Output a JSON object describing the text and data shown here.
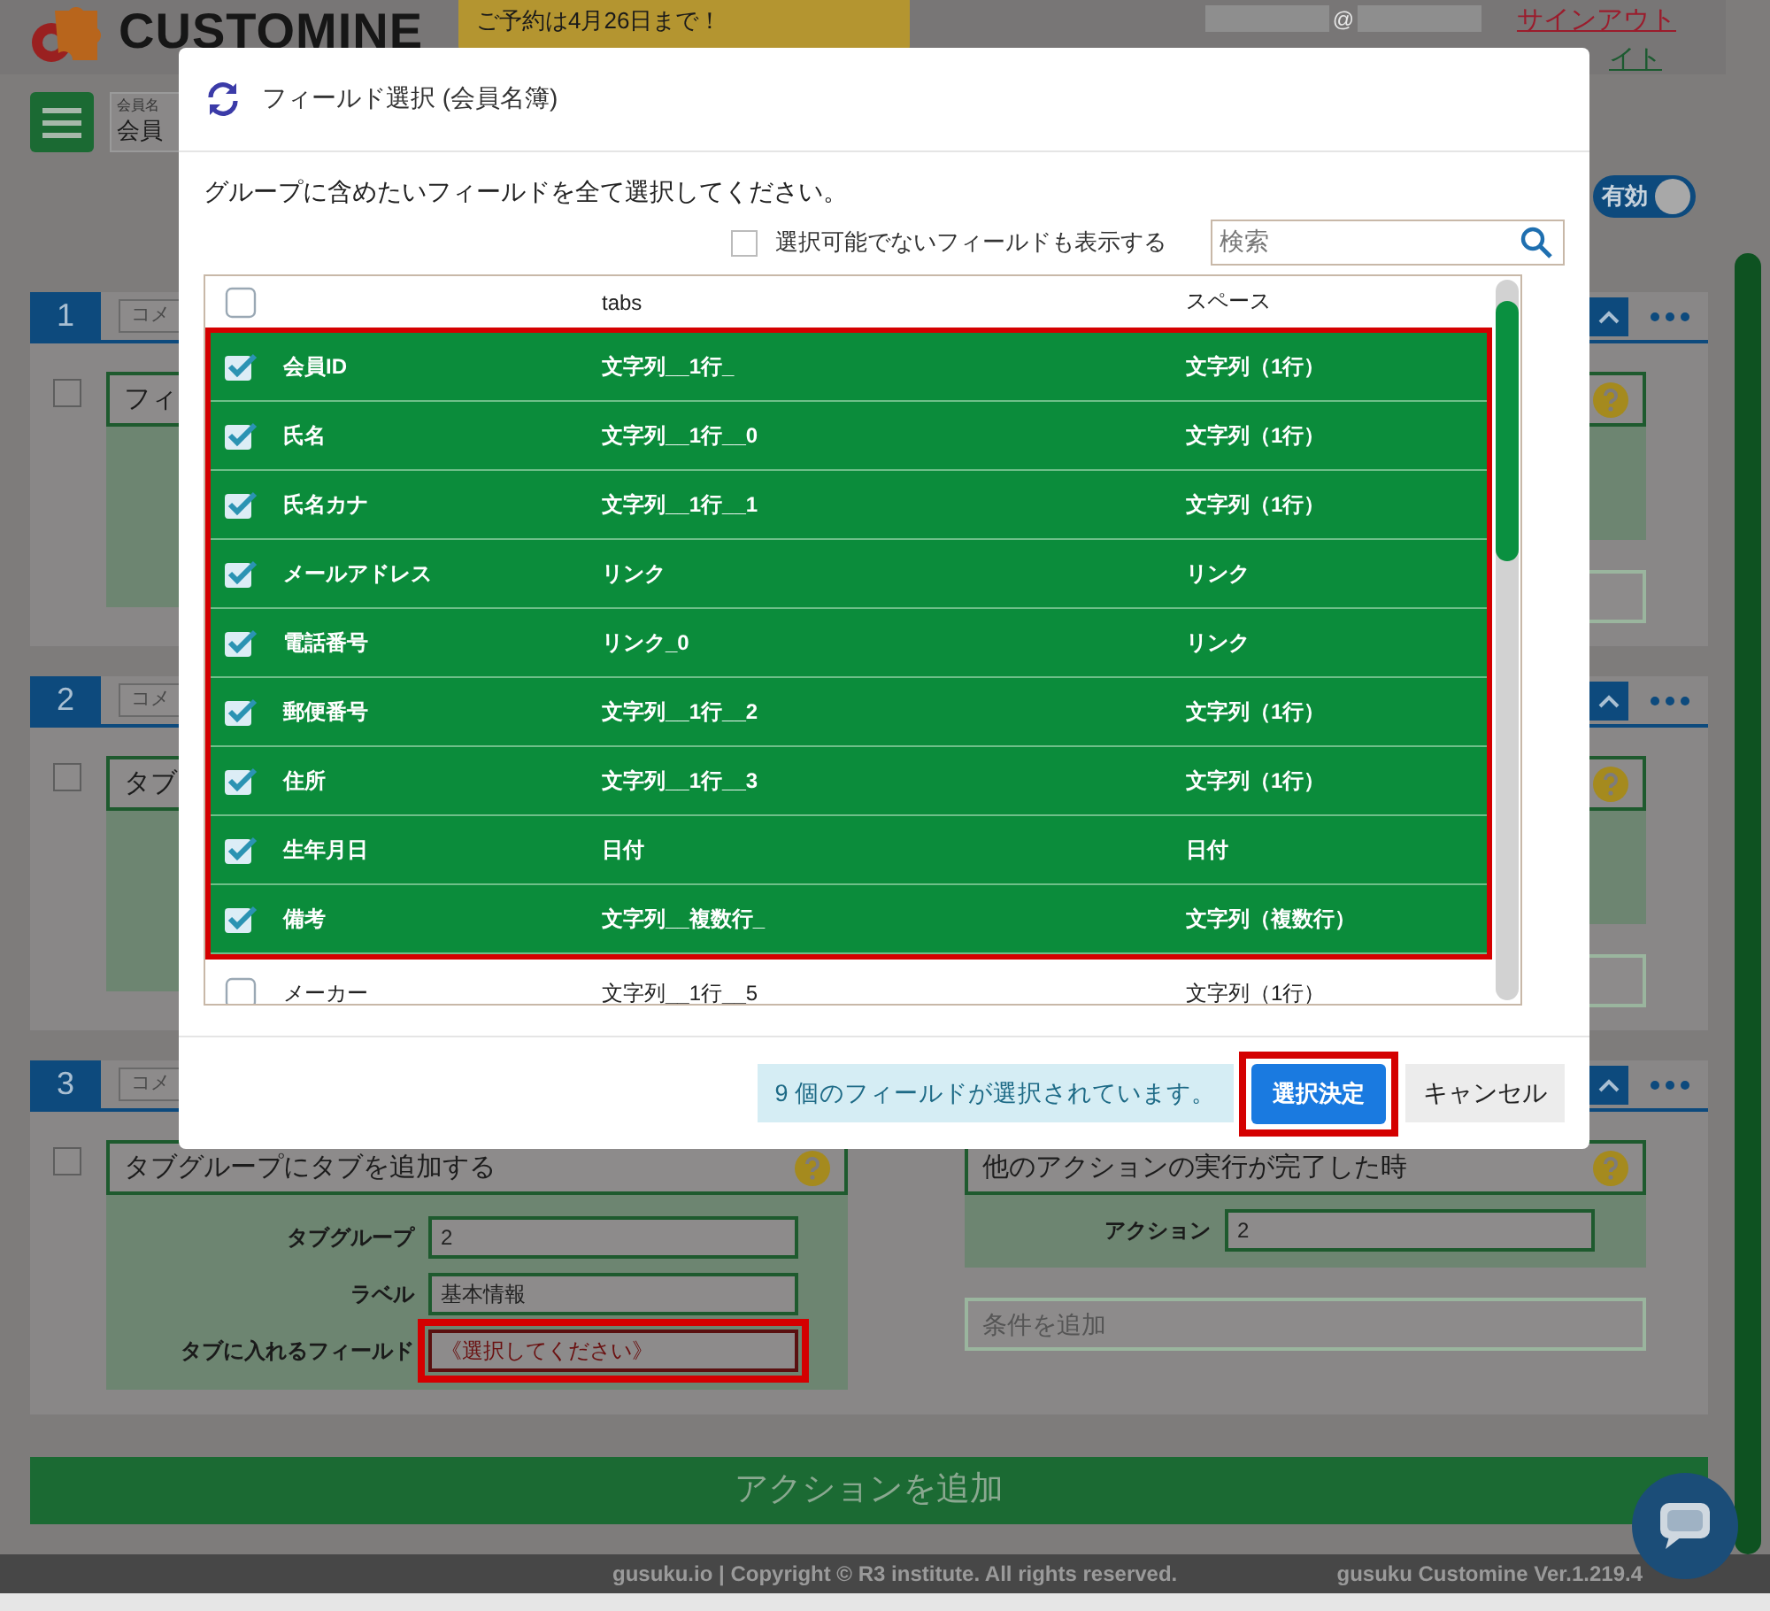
{
  "header": {
    "logo_text": "CUSTOMINE",
    "banner": "ご予約は4月26日まで！",
    "account_at": "@",
    "sign_out": "サインアウト",
    "site_link": "イト"
  },
  "toolbar": {
    "app_select_label": "会員名",
    "app_select_value": "会員",
    "toggle": {
      "label": "有効",
      "on": true
    }
  },
  "actions": [
    {
      "number": "1",
      "comment": "コメ",
      "checked": false,
      "title": "フィ"
    },
    {
      "number": "2",
      "comment": "コメ",
      "checked": false,
      "title": "タブ"
    },
    {
      "number": "3",
      "comment": "コメ",
      "checked": false,
      "title": "タブグループにタブを追加する",
      "fields": [
        {
          "label": "タブグループ",
          "value": "2",
          "highlighted": false
        },
        {
          "label": "ラベル",
          "value": "基本情報",
          "highlighted": false
        },
        {
          "label": "タブに入れるフィールド",
          "value": "《選択してください》",
          "highlighted": true
        }
      ],
      "trigger_title": "他のアクションの実行が完了した時",
      "trigger_fields": [
        {
          "label": "アクション",
          "value": "2"
        }
      ],
      "condition_placeholder": "条件を追加"
    }
  ],
  "add_action": "アクションを追加",
  "footer": {
    "copyright": "gusuku.io | Copyright © R3 institute. All rights reserved.",
    "version": "gusuku Customine Ver.1.219.4"
  },
  "dialog": {
    "title": "フィールド選択 (会員名簿)",
    "instruction": "グループに含めたいフィールドを全て選択してください。",
    "show_unselectable": {
      "label": "選択可能でないフィールドも表示する",
      "checked": false
    },
    "search": {
      "placeholder": "検索"
    },
    "rows": [
      {
        "name": "",
        "code": "tabs",
        "type": "スペース",
        "checked": false
      },
      {
        "name": "会員ID",
        "code": "文字列__1行_",
        "type": "文字列（1行）",
        "checked": true
      },
      {
        "name": "氏名",
        "code": "文字列__1行__0",
        "type": "文字列（1行）",
        "checked": true
      },
      {
        "name": "氏名カナ",
        "code": "文字列__1行__1",
        "type": "文字列（1行）",
        "checked": true
      },
      {
        "name": "メールアドレス",
        "code": "リンク",
        "type": "リンク",
        "checked": true
      },
      {
        "name": "電話番号",
        "code": "リンク_0",
        "type": "リンク",
        "checked": true
      },
      {
        "name": "郵便番号",
        "code": "文字列__1行__2",
        "type": "文字列（1行）",
        "checked": true
      },
      {
        "name": "住所",
        "code": "文字列__1行__3",
        "type": "文字列（1行）",
        "checked": true
      },
      {
        "name": "生年月日",
        "code": "日付",
        "type": "日付",
        "checked": true
      },
      {
        "name": "備考",
        "code": "文字列__複数行_",
        "type": "文字列（複数行）",
        "checked": true
      },
      {
        "name": "メーカー",
        "code": "文字列__1行__5",
        "type": "文字列（1行）",
        "checked": false
      }
    ],
    "selected_count": "9 個のフィールドが選択されています。",
    "confirm": {
      "label": "選択決定",
      "highlighted": true
    },
    "cancel": "キャンセル"
  }
}
